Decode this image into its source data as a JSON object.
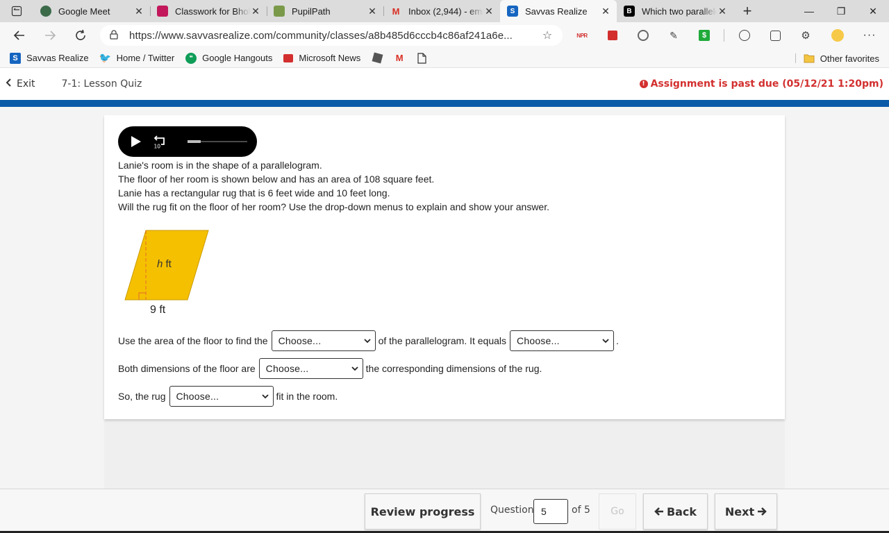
{
  "browser": {
    "tabs": [
      {
        "title": "Google Meet",
        "icon": "google-meet-icon",
        "color": "#1e8e3e"
      },
      {
        "title": "Classwork for Bhola",
        "icon": "classwork-icon",
        "color": "#c2185b"
      },
      {
        "title": "PupilPath",
        "icon": "pupilpath-icon",
        "color": "#5b8c3a"
      },
      {
        "title": "Inbox (2,944) - emn",
        "icon": "gmail-icon",
        "color": "#d93025"
      },
      {
        "title": "Savvas Realize",
        "icon": "savvas-icon",
        "color": "#1565c0",
        "active": true
      },
      {
        "title": "Which two parallelo",
        "icon": "brainly-icon",
        "color": "#000000"
      }
    ],
    "url": "https://www.savvasrealize.com/community/classes/a8b485d6cccb4c86af241a6e...",
    "favorites": [
      {
        "label": "Savvas Realize",
        "icon": "savvas-icon"
      },
      {
        "label": "Home / Twitter",
        "icon": "twitter-icon"
      },
      {
        "label": "Google Hangouts",
        "icon": "hangouts-icon"
      },
      {
        "label": "Microsoft News",
        "icon": "microsoft-news-icon"
      }
    ],
    "other_favorites": "Other favorites"
  },
  "header": {
    "exit_label": "Exit",
    "quiz_title": "7-1: Lesson Quiz",
    "past_due": "Assignment is past due (05/12/21 1:20pm)",
    "accent_color": "#0a5aa8",
    "alert_color": "#d32f2f"
  },
  "audio": {
    "progress_fraction": 0.22
  },
  "question": {
    "lines": [
      "Lanie's room is in the shape of a parallelogram.",
      "The floor of her room is shown below and has an area of 108 square feet.",
      "Lanie has a rectangular rug that is 6 feet wide and 10 feet long.",
      "Will the rug fit on the floor of her room? Use the drop-down menus to explain and show your answer."
    ],
    "figure": {
      "height_label_var": "h",
      "height_label_unit": " ft",
      "base_label": "9 ft",
      "fill_color": "#f5c000"
    }
  },
  "answers": {
    "row1": {
      "before": "Use the area of the floor to find the",
      "middle": "of the parallelogram. It equals",
      "after": ".",
      "select1": "Choose...",
      "select2": "Choose..."
    },
    "row2": {
      "before": "Both dimensions of the floor are",
      "after": "the corresponding dimensions of the rug.",
      "select": "Choose..."
    },
    "row3": {
      "before": "So, the rug",
      "after": "fit in the room.",
      "select": "Choose..."
    }
  },
  "footer": {
    "review_label": "Review progress",
    "question_label": "Question",
    "question_value": "5",
    "of_label": "of 5",
    "go_label": "Go",
    "back_label": "Back",
    "next_label": "Next"
  }
}
